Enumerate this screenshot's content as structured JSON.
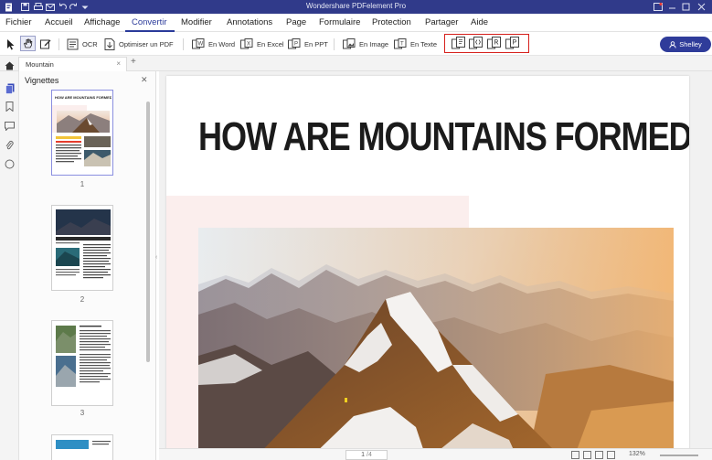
{
  "app": {
    "title": "Wondershare PDFelement Pro"
  },
  "menu": {
    "items": [
      "Fichier",
      "Accueil",
      "Affichage",
      "Convertir",
      "Modifier",
      "Annotations",
      "Page",
      "Formulaire",
      "Protection",
      "Partager",
      "Aide"
    ],
    "active": "Convertir"
  },
  "toolbar": {
    "ocr": "OCR",
    "optimize": "Optimiser un PDF",
    "to_word": "En Word",
    "to_excel": "En Excel",
    "to_ppt": "En PPT",
    "to_image": "En Image",
    "to_text": "En Texte",
    "user": "Shelley",
    "format_icons": [
      "epub-icon",
      "html-icon",
      "rtf-icon",
      "pdfa-icon"
    ]
  },
  "tabs": {
    "document": "Mountain"
  },
  "thumbnails": {
    "title": "Vignettes",
    "pages": [
      "1",
      "2",
      "3"
    ],
    "page1_title": "HOW ARE MOUNTAINS FORMED?"
  },
  "document": {
    "heading": "HOW ARE MOUNTAINS FORMED?"
  },
  "status": {
    "page_current": "1",
    "page_total": "/4",
    "zoom": "132%"
  },
  "colors": {
    "titlebar": "#303a8a",
    "accent": "#2a3a9a",
    "highlight_box": "#d6201c"
  }
}
